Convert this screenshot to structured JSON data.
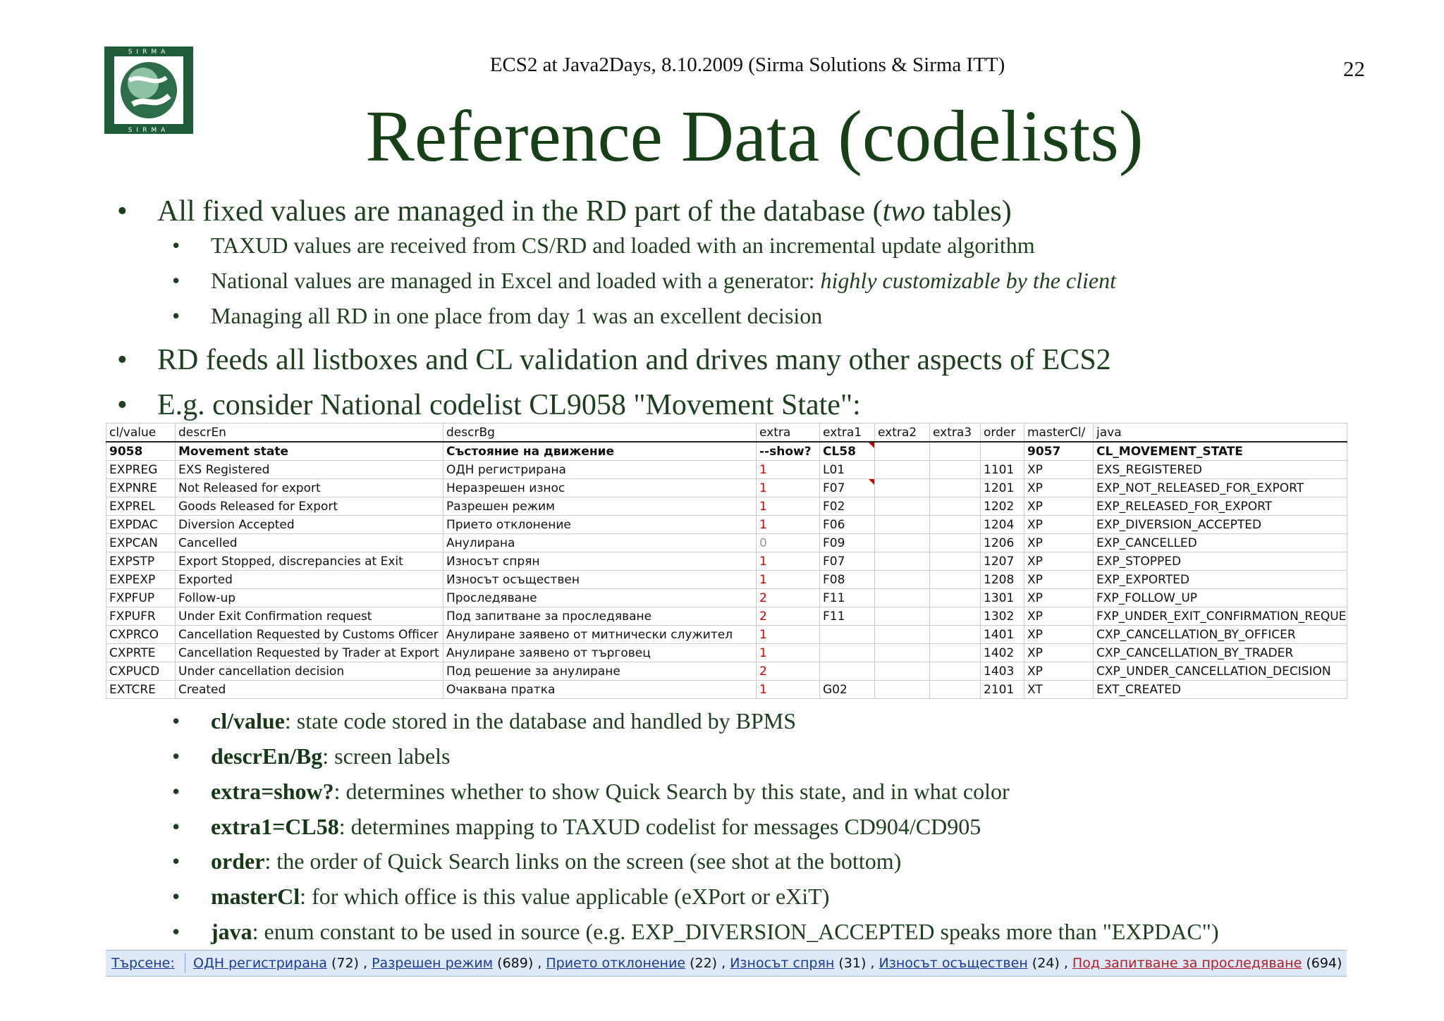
{
  "header": {
    "title": "ECS2 at Java2Days, 8.10.2009 (Sirma Solutions & Sirma ITT)",
    "page_number": "22"
  },
  "logo": {
    "letters": "SIRMA"
  },
  "slide_title": "Reference Data (codelists)",
  "bullets_top": [
    {
      "level": 1,
      "parts": [
        {
          "text": "All fixed values are managed in the RD part of the database ("
        },
        {
          "text": "two",
          "italic": true
        },
        {
          "text": " tables)"
        }
      ]
    },
    {
      "level": 2,
      "parts": [
        {
          "text": "TAXUD values are received from CS/RD and loaded with an incremental update algorithm"
        }
      ]
    },
    {
      "level": 2,
      "parts": [
        {
          "text": "National values are managed in Excel and loaded with a generator: "
        },
        {
          "text": "highly customizable by the client",
          "italic": true
        }
      ]
    },
    {
      "level": 2,
      "parts": [
        {
          "text": "Managing all RD in one place from day 1 was an excellent decision"
        }
      ]
    },
    {
      "level": 1,
      "parts": [
        {
          "text": "RD feeds all listboxes and CL validation and drives many other aspects of ECS2"
        }
      ]
    },
    {
      "level": 1,
      "parts": [
        {
          "text": "E.g. consider National codelist CL9058 \"Movement State\":"
        }
      ]
    }
  ],
  "codelist_table": {
    "columns": [
      "cl/value",
      "descrEn",
      "descrBg",
      "extra",
      "extra1",
      "extra2",
      "extra3",
      "order",
      "masterCl/",
      "java"
    ],
    "rows": [
      [
        "9058",
        "Movement state",
        "Състояние на движение",
        "--show?",
        "CL58",
        "",
        "",
        "",
        "9057",
        "CL_MOVEMENT_STATE"
      ],
      [
        "EXPREG",
        "EXS Registered",
        "ОДН регистрирана",
        "1",
        "L01",
        "",
        "",
        "1101",
        "XP",
        "EXS_REGISTERED"
      ],
      [
        "EXPNRE",
        "Not Released for export",
        "Неразрешен износ",
        "1",
        "F07",
        "",
        "",
        "1201",
        "XP",
        "EXP_NOT_RELEASED_FOR_EXPORT"
      ],
      [
        "EXPREL",
        "Goods Released for Export",
        "Разрешен режим",
        "1",
        "F02",
        "",
        "",
        "1202",
        "XP",
        "EXP_RELEASED_FOR_EXPORT"
      ],
      [
        "EXPDAC",
        "Diversion Accepted",
        "Прието отклонение",
        "1",
        "F06",
        "",
        "",
        "1204",
        "XP",
        "EXP_DIVERSION_ACCEPTED"
      ],
      [
        "EXPCAN",
        "Cancelled",
        "Анулирана",
        "0",
        "F09",
        "",
        "",
        "1206",
        "XP",
        "EXP_CANCELLED"
      ],
      [
        "EXPSTP",
        "Export Stopped, discrepancies at Exit",
        "Износът спрян",
        "1",
        "F07",
        "",
        "",
        "1207",
        "XP",
        "EXP_STOPPED"
      ],
      [
        "EXPEXP",
        "Exported",
        "Износът осъществен",
        "1",
        "F08",
        "",
        "",
        "1208",
        "XP",
        "EXP_EXPORTED"
      ],
      [
        "FXPFUP",
        "Follow-up",
        "Проследяване",
        "2",
        "F11",
        "",
        "",
        "1301",
        "XP",
        "FXP_FOLLOW_UP"
      ],
      [
        "FXPUFR",
        "Under Exit Confirmation request",
        "Под запитване за проследяване",
        "2",
        "F11",
        "",
        "",
        "1302",
        "XP",
        "FXP_UNDER_EXIT_CONFIRMATION_REQUEST"
      ],
      [
        "CXPRCO",
        "Cancellation Requested by Customs Officer",
        "Анулиране заявено от митнически служител",
        "1",
        "",
        "",
        "",
        "1401",
        "XP",
        "CXP_CANCELLATION_BY_OFFICER"
      ],
      [
        "CXPRTE",
        "Cancellation Requested by Trader at Export",
        "Анулиране заявено от търговец",
        "1",
        "",
        "",
        "",
        "1402",
        "XP",
        "CXP_CANCELLATION_BY_TRADER"
      ],
      [
        "CXPUCD",
        "Under cancellation decision",
        "Под решение за анулиране",
        "2",
        "",
        "",
        "",
        "1403",
        "XP",
        "CXP_UNDER_CANCELLATION_DECISION"
      ],
      [
        "EXTCRE",
        "Created",
        "Очаквана пратка",
        "1",
        "G02",
        "",
        "",
        "2101",
        "XT",
        "EXT_CREATED"
      ]
    ]
  },
  "bullets_bottom": [
    {
      "term": "cl/value",
      "desc": ": state code stored in the database and handled by BPMS"
    },
    {
      "term": "descrEn/Bg",
      "desc": ": screen labels"
    },
    {
      "term": "extra=show?",
      "desc": ": determines whether to show Quick Search by this state, and in what color"
    },
    {
      "term": "extra1=CL58",
      "desc": ": determines mapping to TAXUD codelist for messages CD904/CD905"
    },
    {
      "term": "order",
      "desc": ": the order of Quick Search links on the screen (see shot at the bottom)"
    },
    {
      "term": "masterCl",
      "desc": ": for which office is this value applicable (eXPort or eXiT)"
    },
    {
      "term": "java",
      "desc": ": enum constant to be used in source (e.g. EXP_DIVERSION_ACCEPTED speaks more than \"EXPDAC\")"
    }
  ],
  "quick_search": {
    "label": "Търсене:",
    "links": [
      {
        "text": "ОДН регистрирана",
        "count": " (72)",
        "color": "blue"
      },
      {
        "text": "Разрешен режим",
        "count": " (689)",
        "color": "blue"
      },
      {
        "text": "Прието отклонение",
        "count": " (22)",
        "color": "blue"
      },
      {
        "text": "Износът спрян",
        "count": " (31)",
        "color": "blue"
      },
      {
        "text": "Износът осъществен",
        "count": " (24)",
        "color": "blue"
      },
      {
        "text": "Под запитване за проследяване",
        "count": " (694)",
        "color": "red"
      }
    ]
  },
  "colors": {
    "title": "#164016",
    "link": "#1a3a9a",
    "link_alt": "#b0202a",
    "bar_bg": "#dde9f6"
  }
}
